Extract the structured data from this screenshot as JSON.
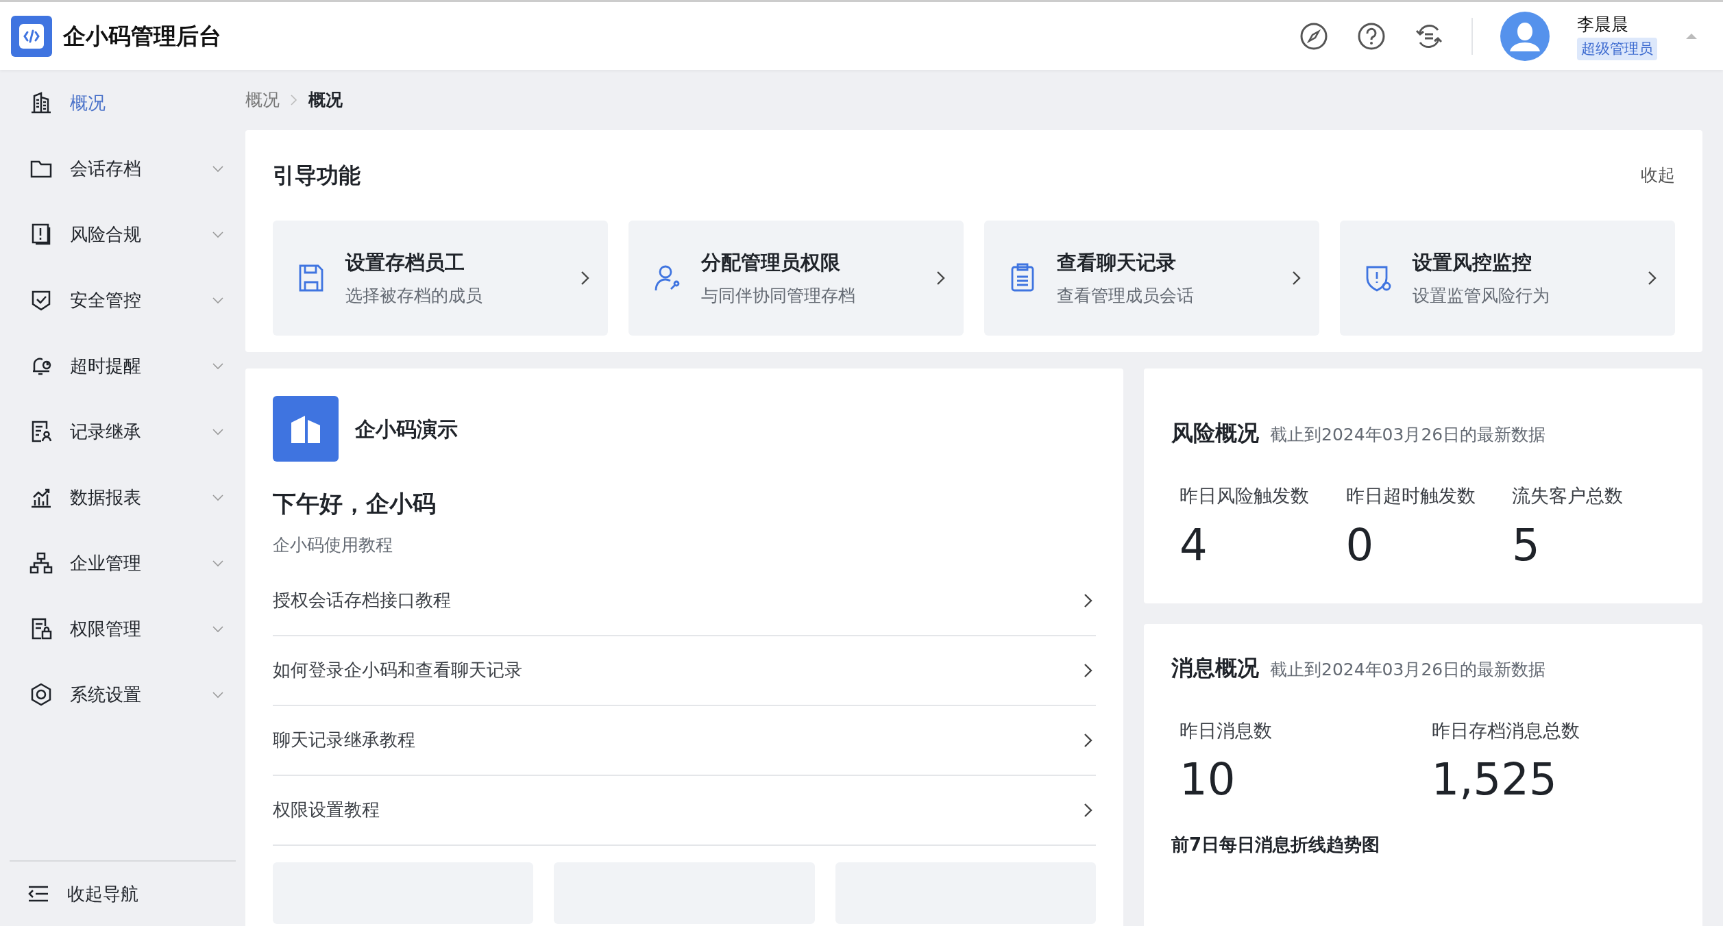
{
  "app": {
    "title": "企小码管理后台"
  },
  "header": {
    "user": {
      "name": "李晨晨",
      "role": "超级管理员"
    }
  },
  "sidebar": {
    "items": [
      {
        "label": "概况",
        "selected": true,
        "expandable": false
      },
      {
        "label": "会话存档",
        "selected": false,
        "expandable": true
      },
      {
        "label": "风险合规",
        "selected": false,
        "expandable": true
      },
      {
        "label": "安全管控",
        "selected": false,
        "expandable": true
      },
      {
        "label": "超时提醒",
        "selected": false,
        "expandable": true
      },
      {
        "label": "记录继承",
        "selected": false,
        "expandable": true
      },
      {
        "label": "数据报表",
        "selected": false,
        "expandable": true
      },
      {
        "label": "企业管理",
        "selected": false,
        "expandable": true
      },
      {
        "label": "权限管理",
        "selected": false,
        "expandable": true
      },
      {
        "label": "系统设置",
        "selected": false,
        "expandable": true
      }
    ],
    "collapse_label": "收起导航"
  },
  "breadcrumb": [
    "概况",
    "概况"
  ],
  "guide": {
    "title": "引导功能",
    "collapse": "收起",
    "cards": [
      {
        "title": "设置存档员工",
        "subtitle": "选择被存档的成员"
      },
      {
        "title": "分配管理员权限",
        "subtitle": "与同伴协同管理存档"
      },
      {
        "title": "查看聊天记录",
        "subtitle": "查看管理成员会话"
      },
      {
        "title": "设置风控监控",
        "subtitle": "设置监管风险行为"
      }
    ]
  },
  "company": {
    "name": "企小码演示",
    "greeting": "下午好，企小码",
    "tutorial_heading": "企小码使用教程",
    "tutorials": [
      "授权会话存档接口教程",
      "如何登录企小码和查看聊天记录",
      "聊天记录继承教程",
      "权限设置教程"
    ]
  },
  "risk": {
    "title": "风险概况",
    "note": "截止到2024年03月26日的最新数据",
    "stats": [
      {
        "label": "昨日风险触发数",
        "value": "4"
      },
      {
        "label": "昨日超时触发数",
        "value": "0"
      },
      {
        "label": "流失客户总数",
        "value": "5"
      }
    ]
  },
  "messages": {
    "title": "消息概况",
    "note": "截止到2024年03月26日的最新数据",
    "stats": [
      {
        "label": "昨日消息数",
        "value": "10"
      },
      {
        "label": "昨日存档消息总数",
        "value": "1,525"
      }
    ],
    "chart_title": "前7日每日消息折线趋势图"
  }
}
